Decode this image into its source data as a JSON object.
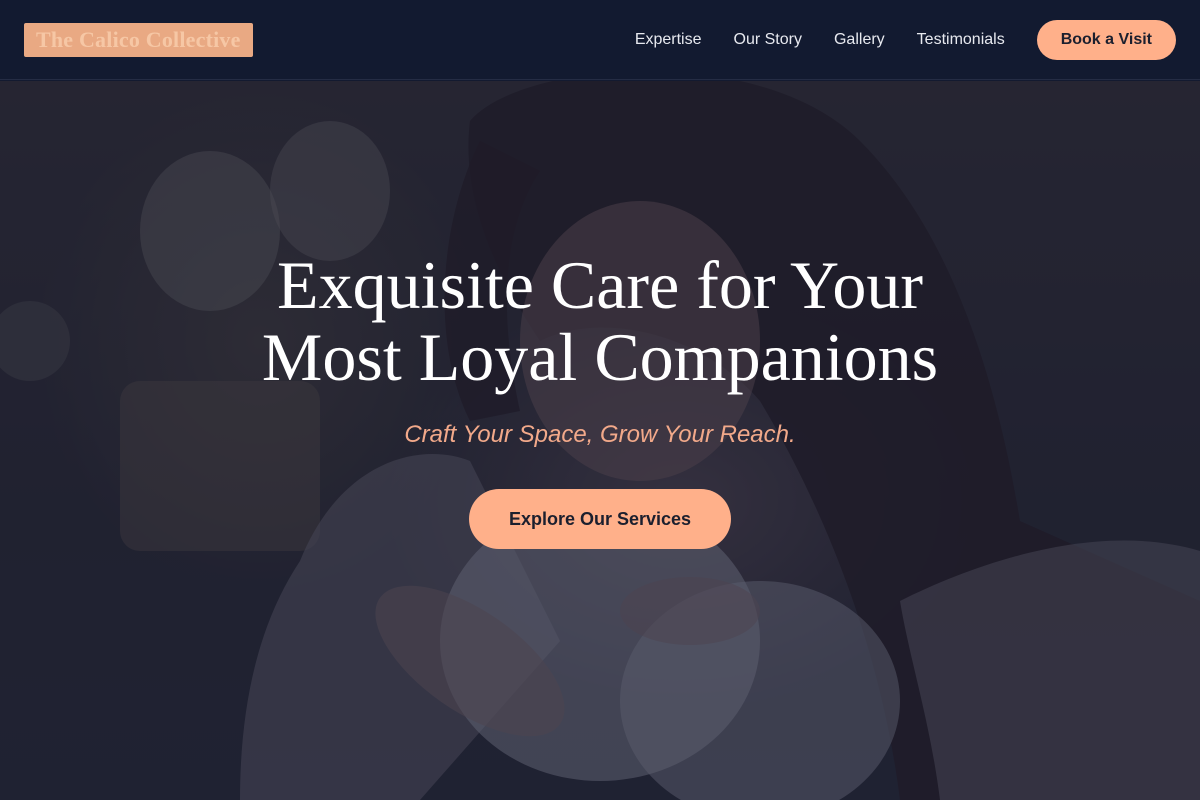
{
  "brand": {
    "name": "The Calico Collective"
  },
  "nav": {
    "links": [
      "Expertise",
      "Our Story",
      "Gallery",
      "Testimonials"
    ],
    "cta": "Book a Visit"
  },
  "hero": {
    "title_line1": "Exquisite Care for Your",
    "title_line2": "Most Loyal Companions",
    "tagline": "Craft Your Space, Grow Your Reach.",
    "cta": "Explore Our Services",
    "image_description": "woman-holding-white-rabbit-photo"
  },
  "colors": {
    "header_bg": "#121a30",
    "accent": "#ffb08a",
    "logo_bg": "#e9a983",
    "tagline": "#f2a98a",
    "overlay": "rgba(22,28,52,0.55)"
  }
}
